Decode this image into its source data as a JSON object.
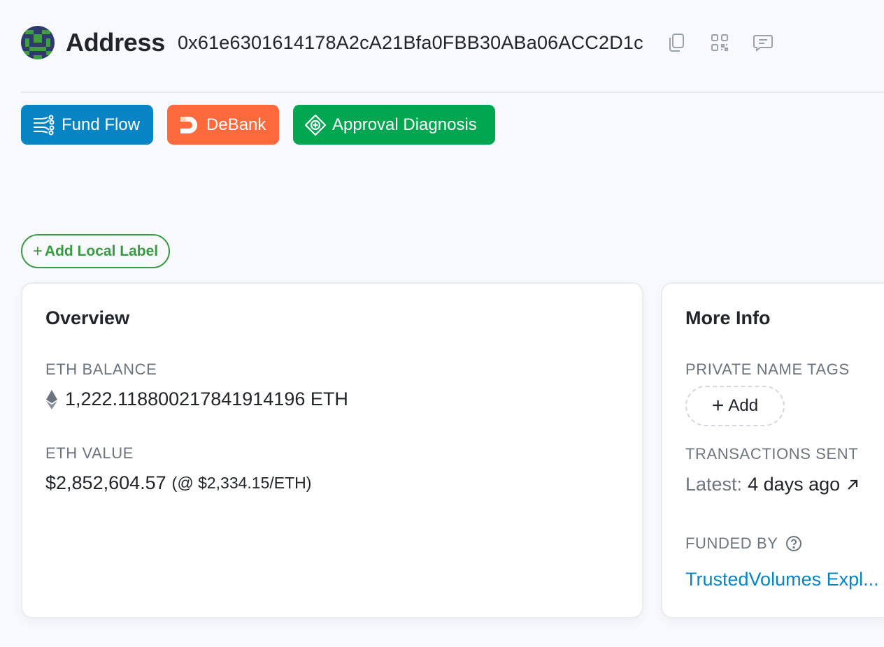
{
  "header": {
    "title": "Address",
    "address": "0x61e6301614178A2cA21Bfa0FBB30ABa06ACC2D1c",
    "icons": [
      "copy-icon",
      "qr-code-icon",
      "comment-icon"
    ]
  },
  "buttons": {
    "fund_flow": "Fund Flow",
    "debank": "DeBank",
    "approval": "Approval Diagnosis"
  },
  "add_local_label": "Add Local Label",
  "overview": {
    "title": "Overview",
    "eth_balance_label": "ETH BALANCE",
    "eth_balance_value": "1,222.118800217841914196 ETH",
    "eth_value_label": "ETH VALUE",
    "eth_value": "$2,852,604.57",
    "eth_rate": "(@ $2,334.15/ETH)"
  },
  "more_info": {
    "title": "More Info",
    "private_tags_label": "PRIVATE NAME TAGS",
    "add_tag": "Add",
    "tx_sent_label": "TRANSACTIONS SENT",
    "latest_prefix": "Latest:",
    "latest_value": "4 days ago",
    "funded_by_label": "FUNDED BY",
    "funded_by_value": "TrustedVolumes Expl..."
  },
  "colors": {
    "fund_flow": "#0784c3",
    "debank": "#fe6a3c",
    "approval": "#00a650",
    "label_green": "#3a9a43",
    "link": "#0784c3"
  }
}
